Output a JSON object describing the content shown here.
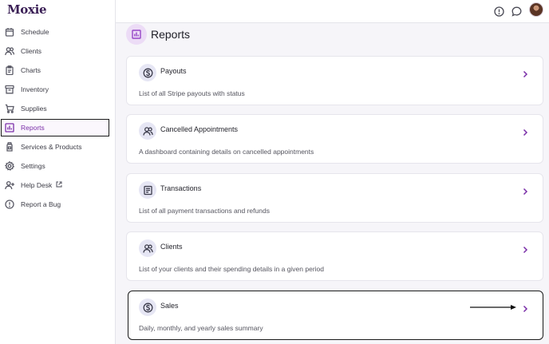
{
  "app": {
    "logo": "Moxie"
  },
  "sidebar": {
    "items": [
      {
        "label": "Schedule",
        "icon": "calendar-icon",
        "active": false
      },
      {
        "label": "Clients",
        "icon": "users-icon",
        "active": false
      },
      {
        "label": "Charts",
        "icon": "clipboard-icon",
        "active": false
      },
      {
        "label": "Inventory",
        "icon": "archive-icon",
        "active": false
      },
      {
        "label": "Supplies",
        "icon": "cart-icon",
        "active": false
      },
      {
        "label": "Reports",
        "icon": "bar-chart-icon",
        "active": true
      },
      {
        "label": "Services & Products",
        "icon": "bottle-icon",
        "active": false
      },
      {
        "label": "Settings",
        "icon": "gear-icon",
        "active": false
      },
      {
        "label": "Help Desk",
        "icon": "user-plus-icon",
        "active": false,
        "external": true
      },
      {
        "label": "Report a Bug",
        "icon": "alert-circle-icon",
        "active": false
      }
    ]
  },
  "topbar": {
    "icons": [
      "info-icon",
      "chat-icon",
      "avatar"
    ]
  },
  "page": {
    "title": "Reports",
    "icon": "bar-chart-icon"
  },
  "reports": [
    {
      "title": "Payouts",
      "description": "List of all Stripe payouts with status",
      "icon": "dollar-circle-icon"
    },
    {
      "title": "Cancelled Appointments",
      "description": "A dashboard containing details on cancelled appointments",
      "icon": "users-icon"
    },
    {
      "title": "Transactions",
      "description": "List of all payment transactions and refunds",
      "icon": "receipt-icon"
    },
    {
      "title": "Clients",
      "description": "List of your clients and their spending details in a given period",
      "icon": "users-icon"
    },
    {
      "title": "Sales",
      "description": "Daily, monthly, and yearly sales summary",
      "icon": "dollar-circle-icon",
      "highlighted": true
    }
  ],
  "colors": {
    "accent": "#7a2ea8",
    "page_bg": "#f6f5f9",
    "card_icon_bg": "#e6e6f4"
  }
}
